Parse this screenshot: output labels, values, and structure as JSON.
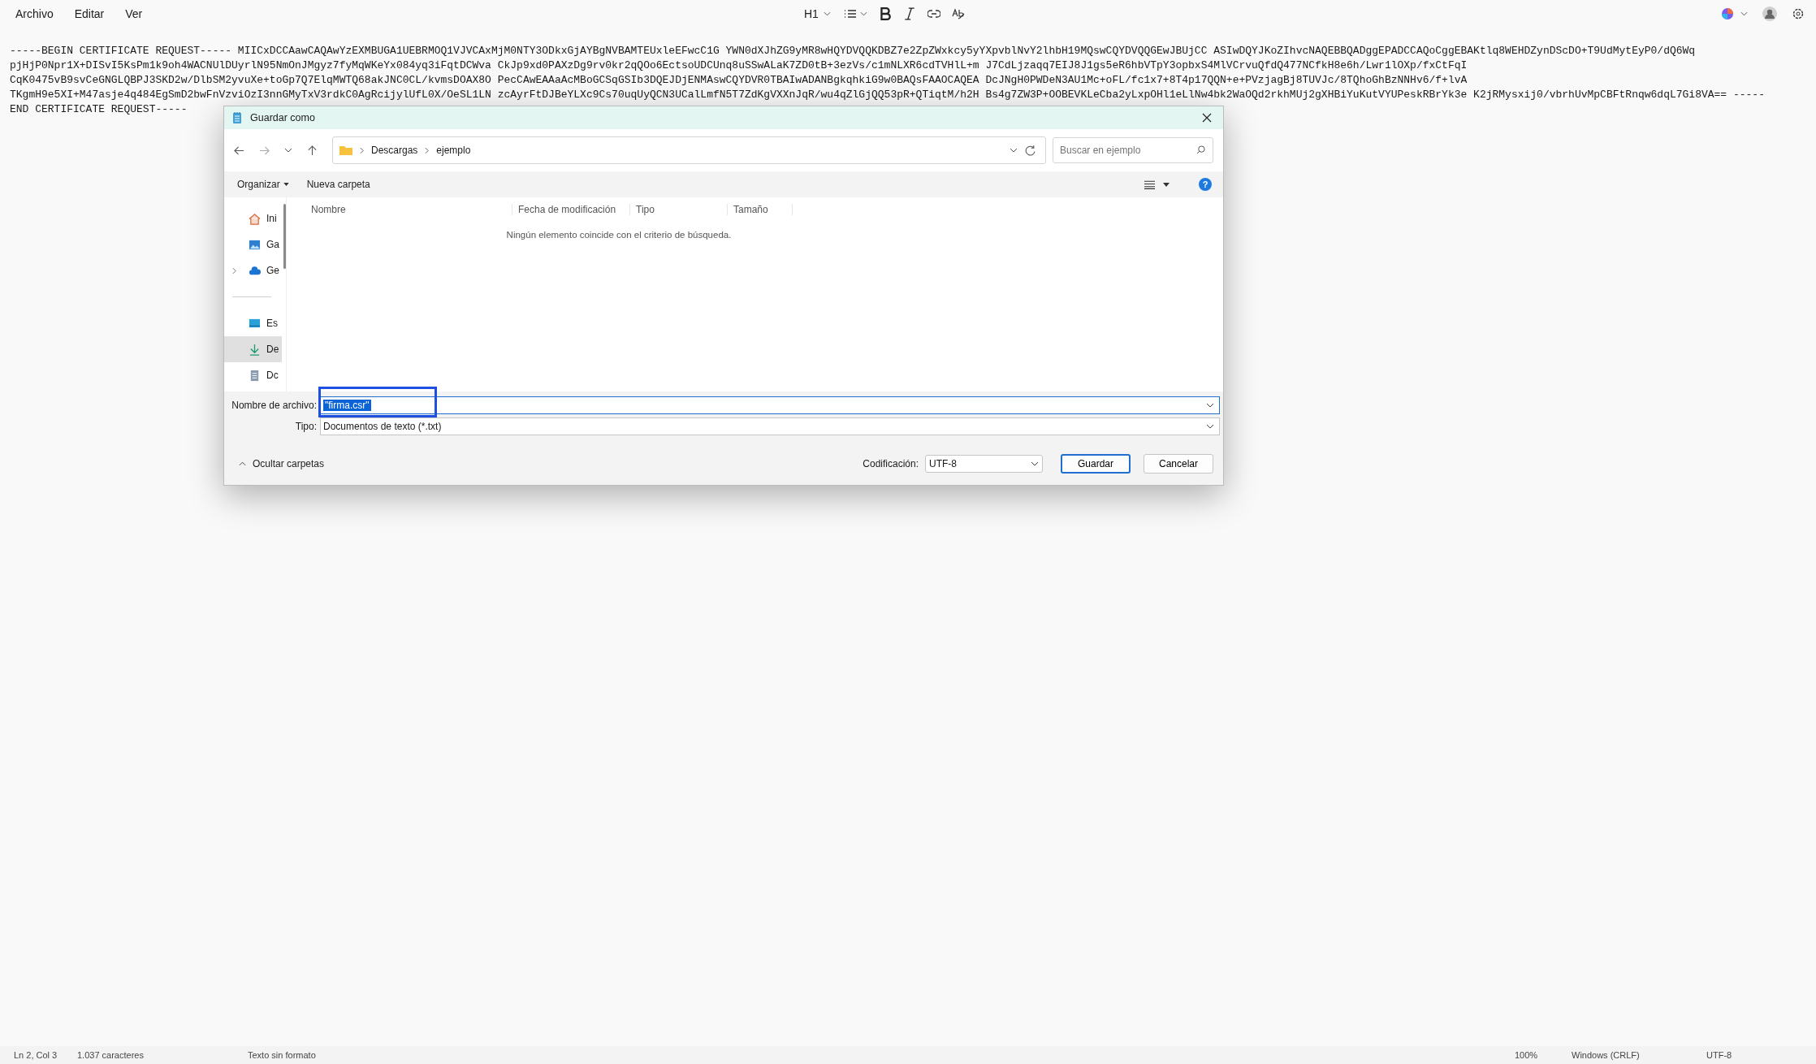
{
  "menu": [
    "Archivo",
    "Editar",
    "Ver"
  ],
  "toolbar": {
    "heading": "H1"
  },
  "document": {
    "lines": [
      "-----BEGIN CERTIFICATE REQUEST----- MIICxDCCAawCAQAwYzEXMBUGA1UEBRMOQ1VJVCAxMjM0NTY3ODkxGjAYBgNVBAMTEUxleEFwcC1G YWN0dXJhZG9yMR8wHQYDVQQKDBZ7e2ZpZWxkcy5yYXpvblNvY2lhbH19MQswCQYDVQQGEwJBUjCC ASIwDQYJKoZIhvcNAQEBBQADggEPADCCAQoCggEBAKtlq8WEHDZynDScDO+T9UdMytEyP0/dQ6Wq",
      "pjHjP0Npr1X+DISvI5KsPm1k9oh4WACNUlDUyrlN95NmOnJMgyz7fyMqWKeYx084yq3iFqtDCWva CkJp9xd0PAXzDg9rv0kr2qQOo6EctsoUDCUnq8uSSwALaK7ZD0tB+3ezVs/c1mNLXR6cdTVHlL+m J7CdLjzaqq7EIJ8J1gs5eR6hbVTpY3opbxS4MlVCrvuQfdQ477NCfkH8e6h/Lwr1lOXp/fxCtFqI",
      "CqK0475vB9svCeGNGLQBPJ3SKD2w/DlbSM2yvuXe+toGp7Q7ElqMWTQ68akJNC0CL/kvmsDOAX8O PecCAwEAAaAcMBoGCSqGSIb3DQEJDjENMAswCQYDVR0TBAIwADANBgkqhkiG9w0BAQsFAAOCAQEA DcJNgH0PWDeN3AU1Mc+oFL/fc1x7+8T4p17QQN+e+PVzjagBj8TUVJc/8TQhoGhBzNNHv6/f+lvA",
      "TKgmH9e5XI+M47asje4q484EgSmD2bwFnVzviOzI3nnGMyTxV3rdkC0AgRcijylUfL0X/OeSL1LN zcAyrFtDJBeYLXc9Cs70uqUyQCN3UCalLmfN5T7ZdKgVXXnJqR/wu4qZlGjQQ53pR+QTiqtM/h2H Bs4g7ZW3P+OOBEVKLeCba2yLxpOHl1eLlNw4bk2WaOQd2rkhMUj2gXHBiYuKutVYUPeskRBrYk3e K2jRMysxij0/vbrhUvMpCBFtRnqw6dqL7Gi8VA== -----",
      "END CERTIFICATE REQUEST-----"
    ]
  },
  "dialog": {
    "title": "Guardar como",
    "path": [
      "Descargas",
      "ejemplo"
    ],
    "search": {
      "placeholder": "Buscar en ejemplo"
    },
    "commands": [
      "Organizar",
      "Nueva carpeta"
    ],
    "help": "?",
    "nav": [
      {
        "label": "Ini",
        "kind": "home",
        "selected": false
      },
      {
        "label": "Ga",
        "kind": "gallery",
        "selected": false
      },
      {
        "label": "Ge",
        "kind": "cloud",
        "selected": false,
        "expandable": true
      },
      {
        "kind": "separator"
      },
      {
        "label": "Es",
        "kind": "desktop",
        "selected": false
      },
      {
        "label": "De",
        "kind": "download",
        "selected": true
      },
      {
        "label": "Dc",
        "kind": "document",
        "selected": false
      }
    ],
    "columns": [
      "Nombre",
      "Fecha de modificación",
      "Tipo",
      "Tamaño"
    ],
    "empty_message": "Ningún elemento coincide con el criterio de búsqueda.",
    "filename": {
      "label": "Nombre de archivo:",
      "value": "\"firma.csr\""
    },
    "type": {
      "label": "Tipo:",
      "value": "Documentos de texto (*.txt)"
    },
    "toggle_folders": "Ocultar carpetas",
    "encoding": {
      "label": "Codificación:",
      "value": "UTF-8"
    },
    "buttons": [
      "Guardar",
      "Cancelar"
    ]
  },
  "status_bar": [
    "Ln 2, Col 3",
    "1.037 caracteres",
    "Texto sin formato",
    "100%",
    "Windows (CRLF)",
    "UTF-8"
  ]
}
